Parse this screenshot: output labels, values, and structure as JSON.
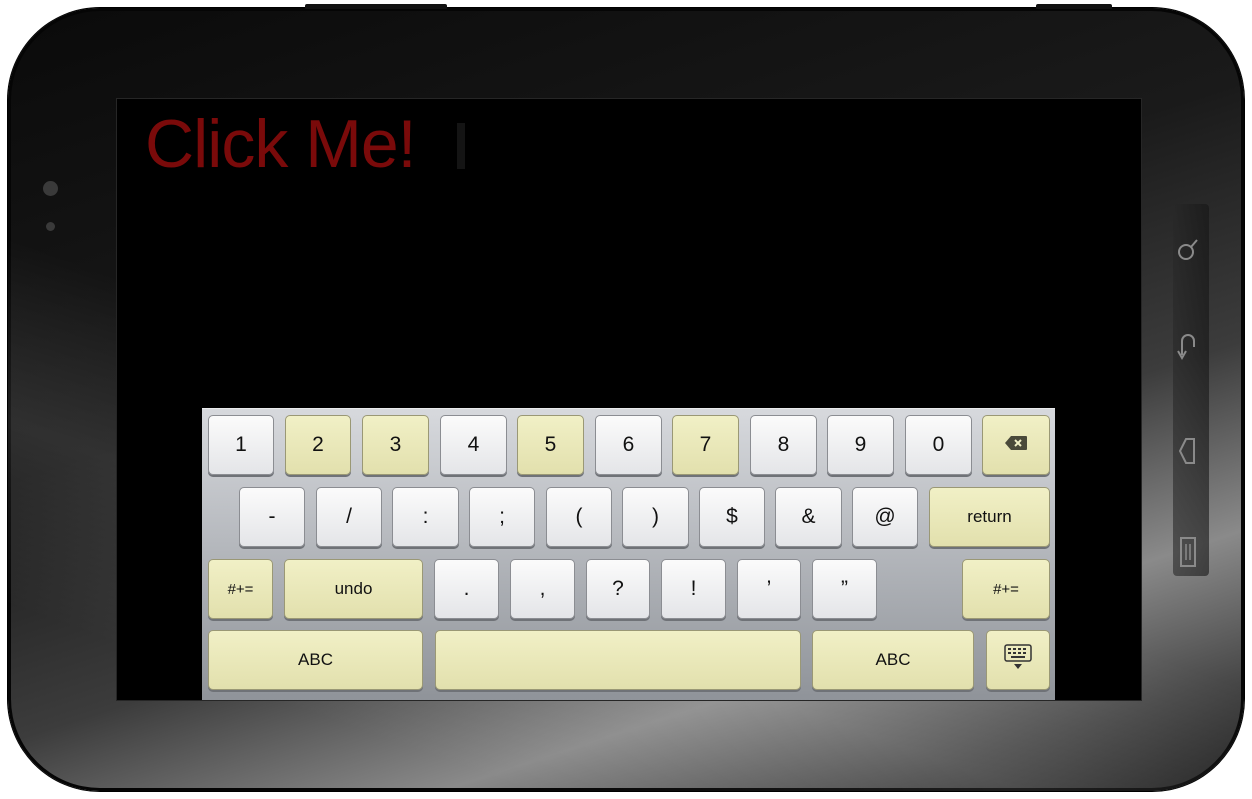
{
  "app": {
    "title_text": "Click Me!"
  },
  "keyboard": {
    "rows": [
      [
        {
          "label": "1",
          "style": "white",
          "name": "key-1"
        },
        {
          "label": "2",
          "style": "yellow",
          "name": "key-2"
        },
        {
          "label": "3",
          "style": "yellow",
          "name": "key-3"
        },
        {
          "label": "4",
          "style": "white",
          "name": "key-4"
        },
        {
          "label": "5",
          "style": "yellow",
          "name": "key-5"
        },
        {
          "label": "6",
          "style": "white",
          "name": "key-6"
        },
        {
          "label": "7",
          "style": "yellow",
          "name": "key-7"
        },
        {
          "label": "8",
          "style": "white",
          "name": "key-8"
        },
        {
          "label": "9",
          "style": "white",
          "name": "key-9"
        },
        {
          "label": "0",
          "style": "white",
          "name": "key-0"
        },
        {
          "label": "",
          "style": "yellow",
          "name": "backspace-key",
          "icon": "backspace-icon"
        }
      ],
      [
        {
          "label": "-",
          "style": "white",
          "name": "key-hyphen"
        },
        {
          "label": "/",
          "style": "white",
          "name": "key-slash"
        },
        {
          "label": ":",
          "style": "white",
          "name": "key-colon"
        },
        {
          "label": ";",
          "style": "white",
          "name": "key-semicolon"
        },
        {
          "label": "(",
          "style": "white",
          "name": "key-open-paren"
        },
        {
          "label": ")",
          "style": "white",
          "name": "key-close-paren"
        },
        {
          "label": "$",
          "style": "white",
          "name": "key-dollar"
        },
        {
          "label": "&",
          "style": "white",
          "name": "key-ampersand"
        },
        {
          "label": "@",
          "style": "white",
          "name": "key-at"
        },
        {
          "label": "return",
          "style": "yellow",
          "name": "return-key"
        }
      ],
      [
        {
          "label": "#+=",
          "style": "yellow",
          "name": "symbols-key-left"
        },
        {
          "label": "undo",
          "style": "yellow",
          "name": "undo-key"
        },
        {
          "label": ".",
          "style": "white",
          "name": "key-period"
        },
        {
          "label": ",",
          "style": "white",
          "name": "key-comma"
        },
        {
          "label": "?",
          "style": "white",
          "name": "key-question"
        },
        {
          "label": "!",
          "style": "white",
          "name": "key-exclamation"
        },
        {
          "label": "’",
          "style": "white",
          "name": "key-apostrophe"
        },
        {
          "label": "”",
          "style": "white",
          "name": "key-quote"
        },
        {
          "label": "#+=",
          "style": "yellow",
          "name": "symbols-key-right"
        }
      ],
      [
        {
          "label": "ABC",
          "style": "yellow",
          "name": "abc-key-left"
        },
        {
          "label": "",
          "style": "yellow",
          "name": "space-key"
        },
        {
          "label": "ABC",
          "style": "yellow",
          "name": "abc-key-right"
        },
        {
          "label": "",
          "style": "yellow",
          "name": "hide-keyboard-key",
          "icon": "hide-keyboard-icon"
        }
      ]
    ]
  },
  "device": {
    "side_buttons": [
      "search-icon",
      "back-icon",
      "home-icon",
      "menu-icon"
    ]
  }
}
